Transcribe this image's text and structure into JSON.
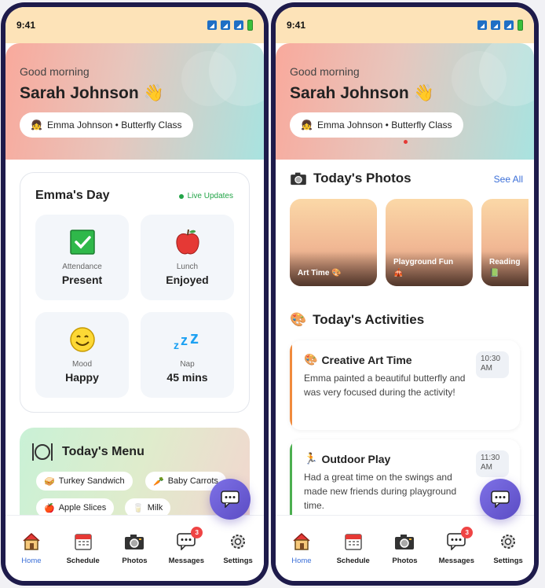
{
  "status": {
    "time": "9:41"
  },
  "header": {
    "greeting": "Good morning",
    "parent_name": "Sarah Johnson",
    "child_chip": "Emma Johnson • Butterfly Class"
  },
  "day": {
    "title": "Emma's Day",
    "live": "Live Updates",
    "tiles": [
      {
        "label": "Attendance",
        "value": "Present",
        "icon": "check-icon"
      },
      {
        "label": "Lunch",
        "value": "Enjoyed",
        "icon": "apple-icon"
      },
      {
        "label": "Mood",
        "value": "Happy",
        "icon": "smile-icon"
      },
      {
        "label": "Nap",
        "value": "45 mins",
        "icon": "zzz-icon"
      }
    ]
  },
  "menu": {
    "title": "Today's Menu",
    "items": [
      "Turkey Sandwich",
      "Baby Carrots",
      "Apple Slices",
      "Milk"
    ]
  },
  "photos": {
    "title": "Today's Photos",
    "see_all": "See All",
    "items": [
      "Art Time",
      "Playground Fun",
      "Reading"
    ]
  },
  "activities": {
    "title": "Today's Activities",
    "items": [
      {
        "title": "Creative Art Time",
        "desc": "Emma painted a beautiful butterfly and was very focused during the activity!",
        "time": "10:30 AM",
        "color": "#f08a3c"
      },
      {
        "title": "Outdoor Play",
        "desc": "Had a great time on the swings and made new friends during playground time.",
        "time": "11:30 AM",
        "color": "#4caf50"
      }
    ]
  },
  "nav": {
    "items": [
      "Home",
      "Schedule",
      "Photos",
      "Messages",
      "Settings"
    ],
    "messages_badge": "3"
  },
  "colors": {
    "accent": "#3b6fd8",
    "live_green": "#22a447",
    "fab": "#6a5bd6"
  }
}
